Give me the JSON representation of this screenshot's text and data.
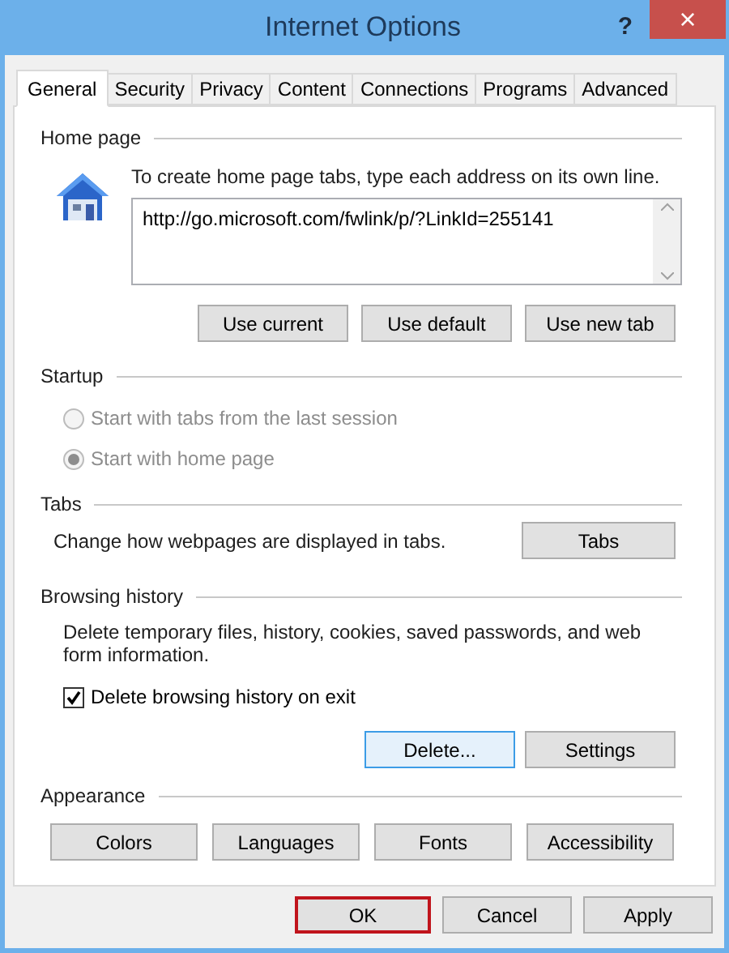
{
  "window": {
    "title": "Internet Options",
    "help": "?",
    "close": "×"
  },
  "tabs": [
    {
      "label": "General",
      "selected": true
    },
    {
      "label": "Security",
      "selected": false
    },
    {
      "label": "Privacy",
      "selected": false
    },
    {
      "label": "Content",
      "selected": false
    },
    {
      "label": "Connections",
      "selected": false
    },
    {
      "label": "Programs",
      "selected": false
    },
    {
      "label": "Advanced",
      "selected": false
    }
  ],
  "home_page": {
    "legend": "Home page",
    "description": "To create home page tabs, type each address on its own line.",
    "value": "http://go.microsoft.com/fwlink/p/?LinkId=255141",
    "buttons": [
      "Use current",
      "Use default",
      "Use new tab"
    ]
  },
  "startup": {
    "legend": "Startup",
    "options": [
      {
        "label": "Start with tabs from the last session",
        "selected": false,
        "disabled": true
      },
      {
        "label": "Start with home page",
        "selected": true,
        "disabled": true
      }
    ]
  },
  "tabs_section": {
    "legend": "Tabs",
    "description": "Change how webpages are displayed in tabs.",
    "button": "Tabs"
  },
  "browsing_history": {
    "legend": "Browsing history",
    "description": "Delete temporary files, history, cookies, saved passwords, and web form information.",
    "checkbox": {
      "label": "Delete browsing history on exit",
      "checked": true
    },
    "buttons": [
      {
        "label": "Delete...",
        "focused": true
      },
      {
        "label": "Settings",
        "focused": false
      }
    ]
  },
  "appearance": {
    "legend": "Appearance",
    "buttons": [
      "Colors",
      "Languages",
      "Fonts",
      "Accessibility"
    ]
  },
  "dialog_buttons": [
    {
      "label": "OK",
      "highlighted": true
    },
    {
      "label": "Cancel",
      "highlighted": false
    },
    {
      "label": "Apply",
      "highlighted": false
    }
  ]
}
